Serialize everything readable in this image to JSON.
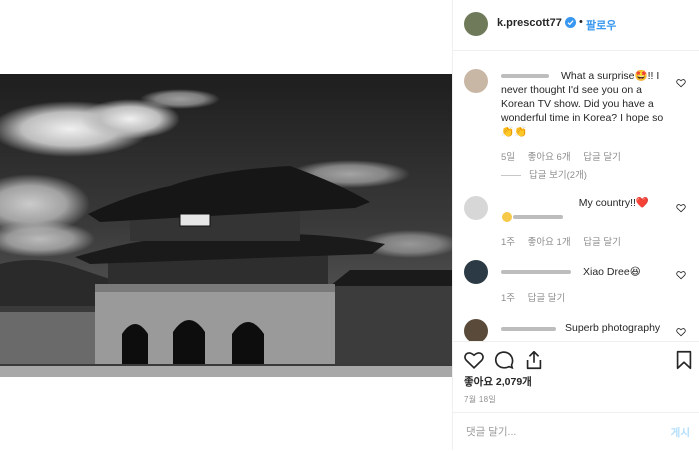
{
  "header": {
    "username": "k.prescott77",
    "dot": "•",
    "follow_label": "팔로우"
  },
  "comments": [
    {
      "text": "What a surprise🤩!! I never thought I'd see you on a Korean TV show. Did you have a wonderful time in Korea? I hope so 👏👏",
      "age": "5일",
      "likes": "좋아요 6개",
      "reply": "답글 달기",
      "view_replies": "답글 보기(2개)"
    },
    {
      "text": "My country!!❤️",
      "age": "1주",
      "likes": "좋아요 1개",
      "reply": "답글 달기"
    },
    {
      "text": "Xiao Dree😆",
      "age": "1주",
      "reply": "답글 달기"
    },
    {
      "text": "Superb photography"
    }
  ],
  "actions": {
    "likes_label": "좋아요 2,079개",
    "date": "7월 18일"
  },
  "composer": {
    "placeholder": "댓글 달기...",
    "post_label": "게시"
  },
  "colors": {
    "accent": "#3897f0",
    "post_disabled": "#b2dffc",
    "meta": "#8e8e8e"
  }
}
